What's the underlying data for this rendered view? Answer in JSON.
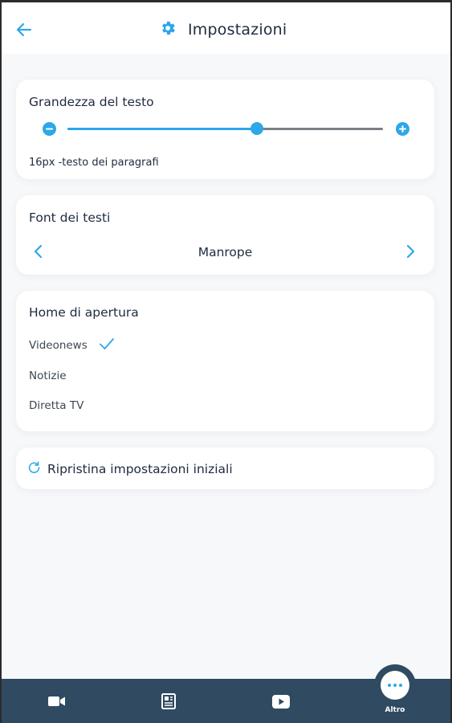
{
  "colors": {
    "accent": "#2da7e8",
    "text_dark": "#1e2b3f",
    "bottom_bar": "#2f4a61",
    "background": "#f7f8fa"
  },
  "header": {
    "title": "Impostazioni",
    "back_icon": "arrow-left-icon",
    "title_icon": "gear-icon"
  },
  "text_size": {
    "title": "Grandezza del testo",
    "decrease_icon": "minus-icon",
    "increase_icon": "plus-icon",
    "slider_value": 0.6,
    "caption": "16px -testo dei paragrafi"
  },
  "font": {
    "title": "Font dei testi",
    "current": "Manrope",
    "prev_icon": "chevron-left-icon",
    "next_icon": "chevron-right-icon"
  },
  "home": {
    "title": "Home di apertura",
    "options": [
      {
        "label": "Videonews",
        "selected": true
      },
      {
        "label": "Notizie",
        "selected": false
      },
      {
        "label": "Diretta TV",
        "selected": false
      }
    ],
    "check_icon": "check-icon"
  },
  "reset": {
    "label": "Ripristina impostazioni iniziali",
    "icon": "reset-icon"
  },
  "bottom_nav": {
    "items": [
      {
        "icon": "video-camera-icon"
      },
      {
        "icon": "newspaper-icon"
      },
      {
        "icon": "play-video-icon"
      }
    ],
    "altro_label": "Altro",
    "altro_icon": "more-dots-icon"
  }
}
